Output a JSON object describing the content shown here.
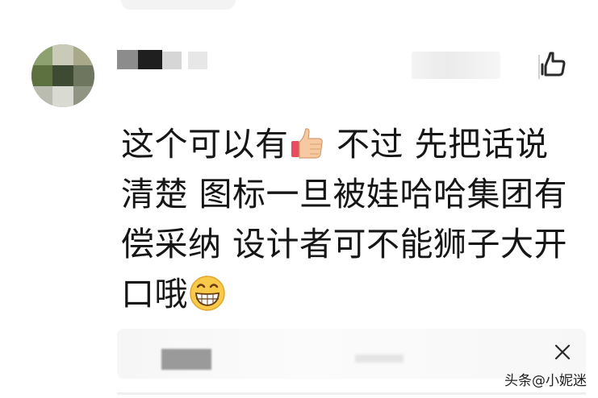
{
  "comment": {
    "lines": [
      {
        "before": "这个可以有",
        "emoji": "thumbs-up",
        "after": " 不过 先把话说"
      },
      {
        "text": "清楚 图标一旦被娃哈哈集团有"
      },
      {
        "text": "偿采纳 设计者可不能狮子大开"
      },
      {
        "before": "口哦",
        "emoji": "grinning-face",
        "after": ""
      }
    ]
  },
  "watermark": {
    "prefix": "头条",
    "handle": "@小妮迷"
  },
  "colors": {
    "text": "#161616",
    "background": "#ffffff",
    "card": "#f6f6f6"
  },
  "icons": {
    "like": "like-icon",
    "close": "close-icon",
    "thumbs_up": "thumbs-up-emoji",
    "grin": "grinning-face-emoji"
  }
}
